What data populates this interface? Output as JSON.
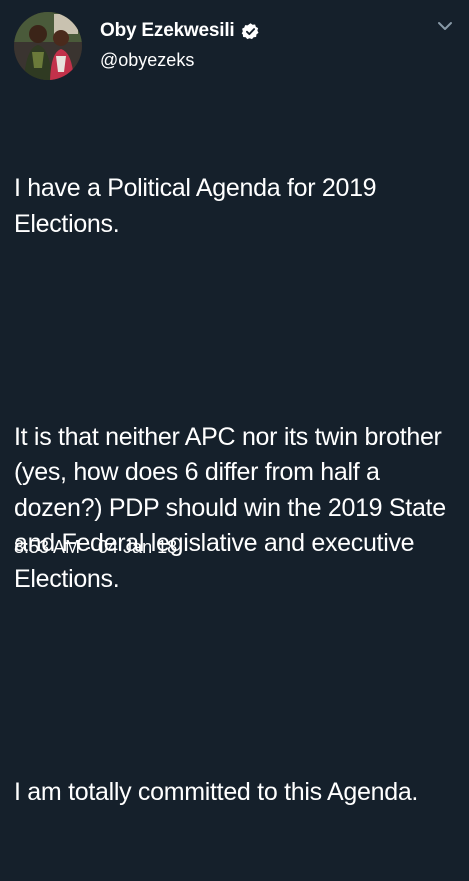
{
  "author": {
    "display_name": "Oby Ezekwesili",
    "handle": "@obyezeks",
    "verified": true,
    "verified_icon": "verified-badge-icon",
    "avatar": "profile-photo"
  },
  "menu": {
    "icon": "chevron-down-icon"
  },
  "tweet": {
    "paragraphs": [
      "I have a Political Agenda for 2019 Elections.",
      "It is that neither APC nor its twin brother (yes, how does 6 differ from half a dozen?) PDP should win the 2019 State and Federal legislative and executive Elections.",
      "I am totally committed to this Agenda."
    ],
    "time": "8:53 AM",
    "separator": "·",
    "date": "04 Jan 18"
  },
  "colors": {
    "background": "#15202b",
    "text": "#ffffff",
    "muted": "#8899a6"
  }
}
